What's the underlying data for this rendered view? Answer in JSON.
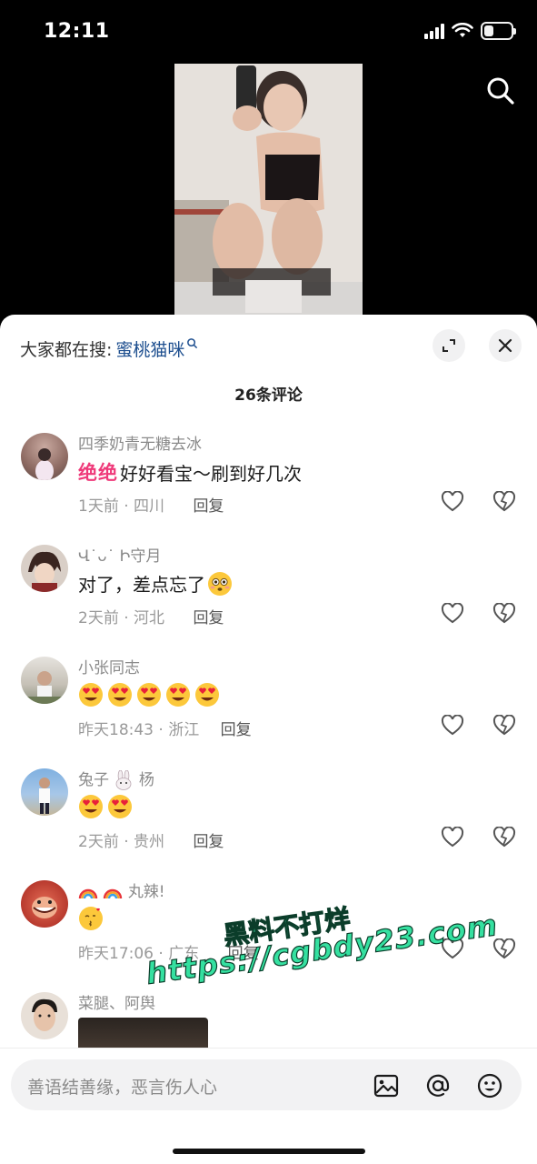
{
  "status_bar": {
    "time": "12:11",
    "battery_level": 0.35
  },
  "video": {
    "search_icon": "search-icon"
  },
  "sheet": {
    "hot_search_label": "大家都在搜:",
    "hot_search_term": "蜜桃猫咪",
    "comment_count": "26条评论",
    "icons": {
      "expand": "expand-icon",
      "close": "close-icon"
    }
  },
  "comments": [
    {
      "user": "四季奶青无糖去冰",
      "badge": "绝绝",
      "text": "好好看宝～刷到好几次",
      "time_loc": "1天前 · 四川",
      "reply": "回复",
      "avatar_color": "#b58f85"
    },
    {
      "user": "Վ˙ᴗ˙ Ի守月",
      "text": "对了，差点忘了",
      "emoji": "flushed",
      "time_loc": "2天前 · 河北",
      "reply": "回复",
      "avatar_color": "#6e5147"
    },
    {
      "user": "小张同志",
      "emoji_count": 5,
      "emoji": "heart-eyes",
      "time_loc": "昨天18:43 · 浙江",
      "reply": "回复",
      "avatar_color": "#c9c0b2"
    },
    {
      "user_prefix": "兔子",
      "user_suffix": "杨",
      "emoji_count": 2,
      "emoji": "heart-eyes",
      "time_loc": "2天前 · 贵州",
      "reply": "回复",
      "avatar_color": "#6d8fb0"
    },
    {
      "user_suffix": "丸辣!",
      "emoji_count": 1,
      "emoji": "kiss-heart",
      "time_loc": "昨天17:06 · 广东",
      "reply": "回复",
      "avatar_color": "#c84a3c"
    },
    {
      "user": "菜腿、阿舆",
      "avatar_color": "#d7c9bd"
    }
  ],
  "watermark": {
    "line1": "黑料不打烊",
    "line2": "https://cgbdy23.com"
  },
  "input_bar": {
    "placeholder": "善语结善缘，恶言伤人心",
    "icons": [
      "image-icon",
      "at-icon",
      "emoji-icon"
    ]
  },
  "colors": {
    "accent_pink": "#ef3a7a",
    "link_blue": "#1e4f8f",
    "watermark_green": "#35e0a0"
  }
}
